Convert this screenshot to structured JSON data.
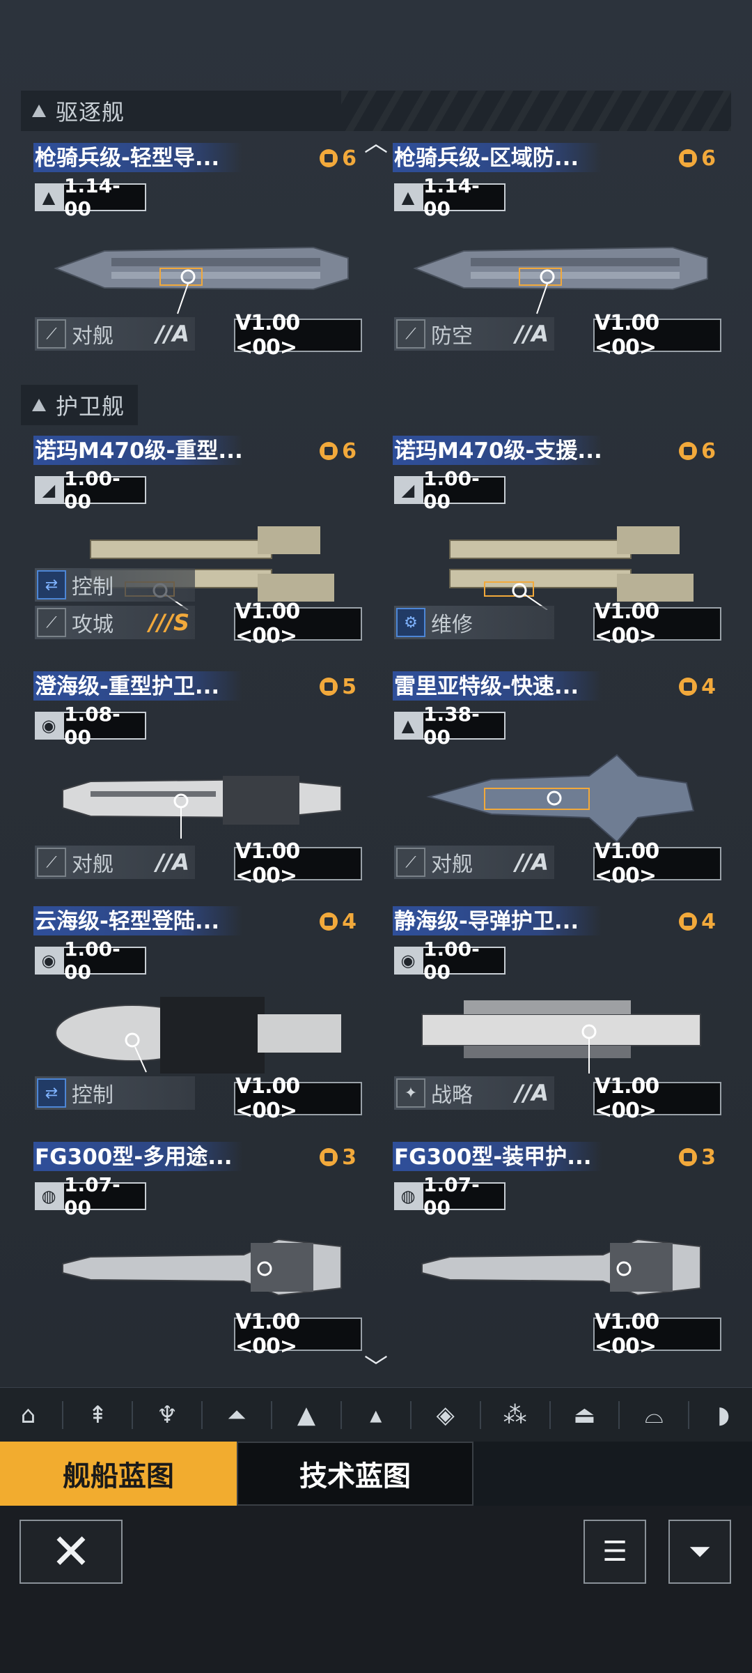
{
  "sections": [
    {
      "label": "驱逐舰"
    },
    {
      "label": "护卫舰"
    }
  ],
  "cards": [
    {
      "name": "枪骑兵级-轻型导...",
      "cost": "6",
      "stat_icon": "missile-icon",
      "stat": "1.14-00",
      "tags": [
        {
          "label": "对舰",
          "grade": "//A",
          "icon": "anti-ship-icon"
        }
      ],
      "version": "V1.00 <00>"
    },
    {
      "name": "枪骑兵级-区域防...",
      "cost": "6",
      "stat_icon": "missile-icon",
      "stat": "1.14-00",
      "tags": [
        {
          "label": "防空",
          "grade": "//A",
          "icon": "anti-air-icon"
        }
      ],
      "version": "V1.00 <00>"
    },
    {
      "name": "诺玛M470级-重型...",
      "cost": "6",
      "stat_icon": "cannon-icon",
      "stat": "1.00-00",
      "tags": [
        {
          "label": "控制",
          "grade": "",
          "icon": "control-icon"
        },
        {
          "label": "攻城",
          "grade": "///S",
          "icon": "siege-icon"
        }
      ],
      "version": "V1.00 <00>"
    },
    {
      "name": "诺玛M470级-支援...",
      "cost": "6",
      "stat_icon": "cannon-icon",
      "stat": "1.00-00",
      "tags": [
        {
          "label": "维修",
          "grade": "",
          "icon": "repair-icon"
        }
      ],
      "version": "V1.00 <00>"
    },
    {
      "name": "澄海级-重型护卫...",
      "cost": "5",
      "stat_icon": "shield-icon",
      "stat": "1.08-00",
      "tags": [
        {
          "label": "对舰",
          "grade": "//A",
          "icon": "anti-ship-icon"
        }
      ],
      "version": "V1.00 <00>"
    },
    {
      "name": "雷里亚特级-快速...",
      "cost": "4",
      "stat_icon": "missile-icon",
      "stat": "1.38-00",
      "tags": [
        {
          "label": "对舰",
          "grade": "//A",
          "icon": "anti-ship-icon"
        }
      ],
      "version": "V1.00 <00>"
    },
    {
      "name": "云海级-轻型登陆...",
      "cost": "4",
      "stat_icon": "shield-icon",
      "stat": "1.00-00",
      "tags": [
        {
          "label": "控制",
          "grade": "",
          "icon": "control-icon"
        }
      ],
      "version": "V1.00 <00>"
    },
    {
      "name": "静海级-导弹护卫...",
      "cost": "4",
      "stat_icon": "shield-icon",
      "stat": "1.00-00",
      "tags": [
        {
          "label": "战略",
          "grade": "//A",
          "icon": "strategy-icon"
        }
      ],
      "version": "V1.00 <00>"
    },
    {
      "name": "FG300型-多用途...",
      "cost": "3",
      "stat_icon": "globe-icon",
      "stat": "1.07-00",
      "tags": [],
      "version": "V1.00 <00>"
    },
    {
      "name": "FG300型-装甲护...",
      "cost": "3",
      "stat_icon": "globe-icon",
      "stat": "1.07-00",
      "tags": [],
      "version": "V1.00 <00>"
    }
  ],
  "tabs": {
    "ship_blueprint": "舰船蓝图",
    "tech_blueprint": "技术蓝图"
  },
  "filter_icons": [
    "base-icon",
    "carrier-icon",
    "cruiser-icon",
    "destroyer-icon",
    "frigate-icon",
    "corvette-icon",
    "layer-icon",
    "fighter-icon",
    "station-icon",
    "dome-icon",
    "hangar-icon"
  ],
  "colors": {
    "accent": "#f2ac2f",
    "name_bar": "#2f4f9a",
    "cost": "#f2a93b"
  }
}
